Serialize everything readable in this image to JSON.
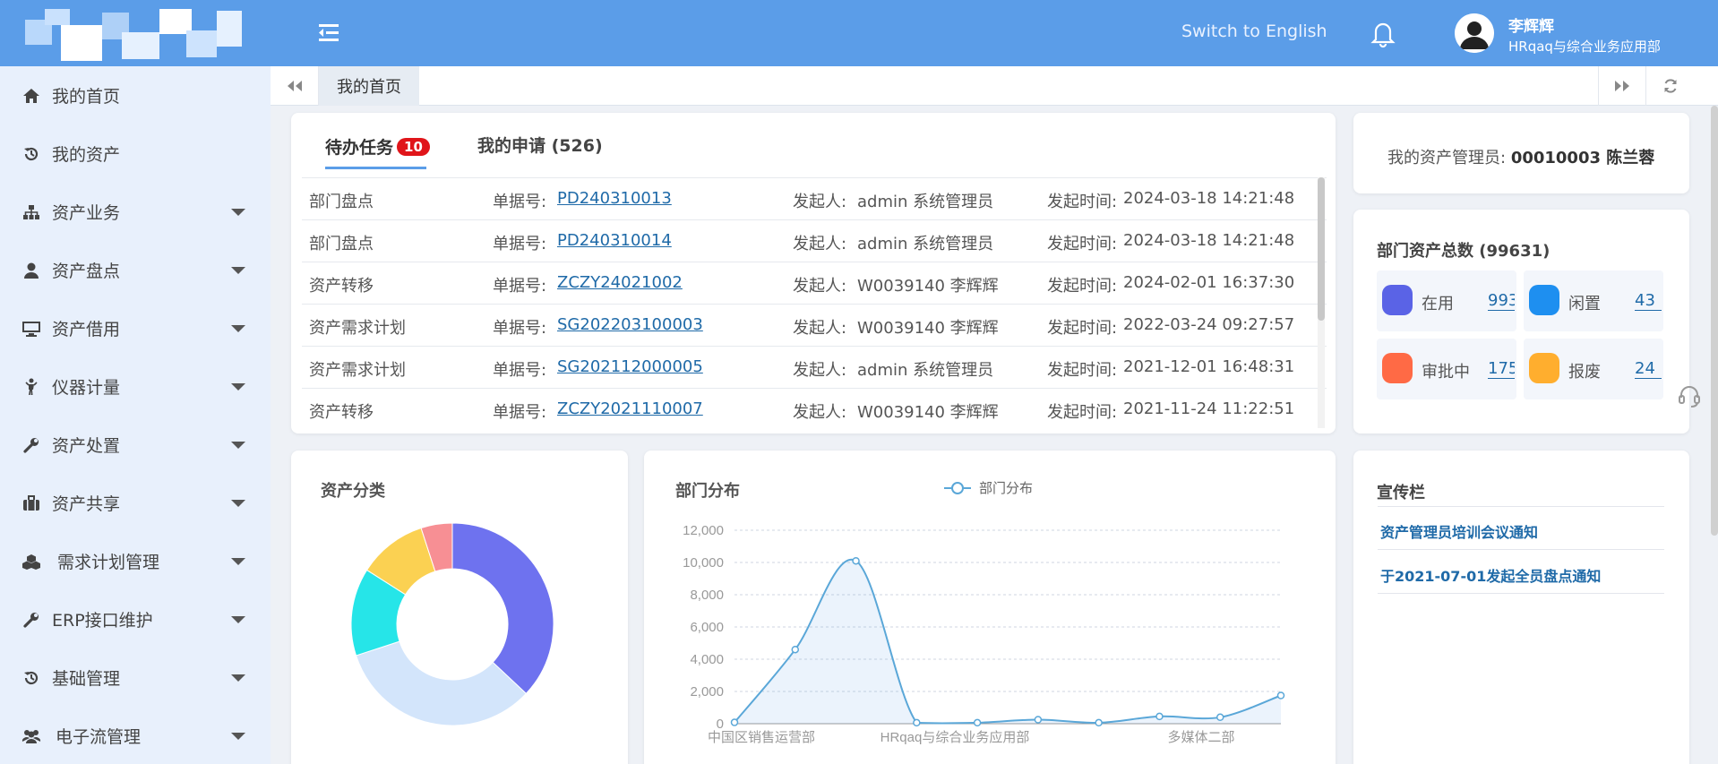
{
  "header": {
    "switch_lang": "Switch to English",
    "user_name": "李辉辉",
    "user_dept": "HRqaq与综合业务应用部"
  },
  "sidebar": {
    "items": [
      {
        "label": "我的首页",
        "icon": "home-icon",
        "caret": false
      },
      {
        "label": "我的资产",
        "icon": "history-icon",
        "caret": false
      },
      {
        "label": "资产业务",
        "icon": "sitemap-icon",
        "caret": true
      },
      {
        "label": "资产盘点",
        "icon": "user-icon",
        "caret": true
      },
      {
        "label": "资产借用",
        "icon": "monitor-icon",
        "caret": true
      },
      {
        "label": "仪器计量",
        "icon": "child-icon",
        "caret": true
      },
      {
        "label": "资产处置",
        "icon": "wrench-icon",
        "caret": true
      },
      {
        "label": "资产共享",
        "icon": "briefcase-icon",
        "caret": true
      },
      {
        "label": "需求计划管理",
        "icon": "cubes-icon",
        "caret": true
      },
      {
        "label": "ERP接口维护",
        "icon": "wrench-icon",
        "caret": true
      },
      {
        "label": "基础管理",
        "icon": "history-icon",
        "caret": true
      },
      {
        "label": "电子流管理",
        "icon": "users-icon",
        "caret": true
      }
    ]
  },
  "tabstrip": {
    "active_tab": "我的首页"
  },
  "tasks": {
    "tab_todo": "待办任务",
    "todo_count": "10",
    "tab_apply": "我的申请 (526)",
    "rows": [
      {
        "type": "部门盘点",
        "no_label": "单据号:",
        "no": "PD240310013",
        "by_label": "发起人:",
        "by": "admin 系统管理员",
        "time_label": "发起时间:",
        "time": "2024-03-18 14:21:48"
      },
      {
        "type": "部门盘点",
        "no_label": "单据号:",
        "no": "PD240310014",
        "by_label": "发起人:",
        "by": "admin 系统管理员",
        "time_label": "发起时间:",
        "time": "2024-03-18 14:21:48"
      },
      {
        "type": "资产转移",
        "no_label": "单据号:",
        "no": "ZCZY24021002",
        "by_label": "发起人:",
        "by": "W0039140 李辉辉",
        "time_label": "发起时间:",
        "time": "2024-02-01 16:37:30"
      },
      {
        "type": "资产需求计划",
        "no_label": "单据号:",
        "no": "SG202203100003",
        "by_label": "发起人:",
        "by": "W0039140 李辉辉",
        "time_label": "发起时间:",
        "time": "2022-03-24 09:27:57"
      },
      {
        "type": "资产需求计划",
        "no_label": "单据号:",
        "no": "SG202112000005",
        "by_label": "发起人:",
        "by": "admin 系统管理员",
        "time_label": "发起时间:",
        "time": "2021-12-01 16:48:31"
      },
      {
        "type": "资产转移",
        "no_label": "单据号:",
        "no": "ZCZY2021110007",
        "by_label": "发起人:",
        "by": "W0039140 李辉辉",
        "time_label": "发起时间:",
        "time": "2021-11-24 11:22:51"
      }
    ]
  },
  "manager": {
    "label": "我的资产管理员:",
    "value": "00010003 陈兰蓉"
  },
  "dept_assets": {
    "title": "部门资产总数 (99631)",
    "stats": [
      {
        "label": "在用",
        "value": "993",
        "color": "#5a63e6"
      },
      {
        "label": "闲置",
        "value": "43",
        "color": "#1e8ff0"
      },
      {
        "label": "审批中",
        "value": "175",
        "color": "#ff6a45"
      },
      {
        "label": "报废",
        "value": "24",
        "color": "#ffae2e"
      }
    ]
  },
  "asset_category": {
    "title": "资产分类"
  },
  "dept_dist": {
    "title": "部门分布"
  },
  "news": {
    "title": "宣传栏",
    "items": [
      "资产管理员培训会议通知",
      "于2021-07-01发起全员盘点通知"
    ]
  },
  "chart_data": [
    {
      "type": "pie",
      "title": "资产分类",
      "slices": [
        {
          "value": 37,
          "color": "#6e72ef"
        },
        {
          "value": 33,
          "color": "#d3e5fb"
        },
        {
          "value": 14,
          "color": "#26e5e8"
        },
        {
          "value": 11,
          "color": "#fbd152"
        },
        {
          "value": 5,
          "color": "#f78f94"
        }
      ]
    },
    {
      "type": "line",
      "title": "部门分布",
      "legend": [
        "部门分布"
      ],
      "x_tick_labels": [
        "中国区销售运营部",
        "HRqaq与综合业务应用部",
        "多媒体二部"
      ],
      "ylim": [
        0,
        12000
      ],
      "yticks": [
        "0",
        "2,000",
        "4,000",
        "6,000",
        "8,000",
        "10,000",
        "12,000"
      ],
      "series": [
        {
          "name": "部门分布",
          "values": [
            80,
            4600,
            10100,
            60,
            60,
            250,
            60,
            450,
            400,
            1750
          ]
        }
      ]
    }
  ]
}
